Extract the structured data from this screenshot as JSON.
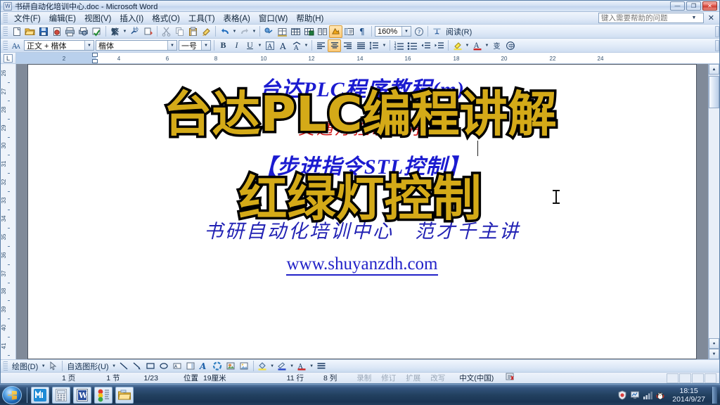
{
  "window": {
    "title": "书研自动化培训中心.doc - Microsoft Word",
    "app_icon": "word-document-icon",
    "minimize_label": "—",
    "restore_label": "❐",
    "close_label": "✕"
  },
  "menu": {
    "items": [
      {
        "label": "文件(F)",
        "name": "menu-file"
      },
      {
        "label": "编辑(E)",
        "name": "menu-edit"
      },
      {
        "label": "视图(V)",
        "name": "menu-view"
      },
      {
        "label": "插入(I)",
        "name": "menu-insert"
      },
      {
        "label": "格式(O)",
        "name": "menu-format"
      },
      {
        "label": "工具(T)",
        "name": "menu-tools"
      },
      {
        "label": "表格(A)",
        "name": "menu-table"
      },
      {
        "label": "窗口(W)",
        "name": "menu-window"
      },
      {
        "label": "帮助(H)",
        "name": "menu-help"
      }
    ],
    "help_box": {
      "placeholder": "键入需要帮助的问题",
      "value": "",
      "close_label": "✕"
    }
  },
  "standard_toolbar": {
    "zoom_value": "160%",
    "read_label": "阅读(R)",
    "buttons": [
      "new-document-icon",
      "open-folder-icon",
      "save-icon",
      "permission-icon",
      "print-icon",
      "print-preview-icon",
      "spell-check-icon",
      "traditional-chinese-icon",
      "research-icon",
      "translate-icon",
      "cut-icon",
      "copy-icon",
      "paste-icon",
      "format-painter-icon",
      "undo-icon",
      "redo-icon",
      "insert-hyperlink-icon",
      "tables-borders-icon",
      "insert-table-icon",
      "insert-excel-sheet-icon",
      "columns-icon",
      "drawing-icon",
      "document-map-icon",
      "show-formatting-icon",
      "help-icon"
    ]
  },
  "formatting_toolbar": {
    "style": "正文 + 楷体",
    "font": "楷体",
    "size": "一号",
    "bold_label": "B",
    "italic_label": "I",
    "underline_label": "U",
    "align_active": "center",
    "buttons": [
      "styles-formatting-icon",
      "bold-icon",
      "italic-icon",
      "underline-icon",
      "border-icon",
      "character-border-icon",
      "character-shading-icon",
      "align-left-icon",
      "align-center-icon",
      "align-right-icon",
      "justify-icon",
      "line-spacing-icon",
      "numbered-list-icon",
      "bulleted-list-icon",
      "decrease-indent-icon",
      "increase-indent-icon",
      "highlight-icon",
      "font-color-icon",
      "grow-font-icon",
      "phonetic-guide-icon"
    ]
  },
  "ruler": {
    "tab_stop_label": "L",
    "horizontal_ticks": [
      "2",
      "4",
      "6",
      "8",
      "10",
      "12",
      "14",
      "16",
      "18",
      "20",
      "22",
      "24"
    ],
    "vertical_ticks": [
      "26",
      "27",
      "28",
      "29",
      "30",
      "31",
      "32",
      "33",
      "34",
      "35",
      "36",
      "37",
      "38",
      "39",
      "40",
      "41"
    ]
  },
  "document": {
    "line_blue_top": "台达PLC程序教程(m)",
    "line_red": "交通灯控制程序",
    "line_blue_bottom": "【步进指令STL控制】",
    "line_center": "书研自动化培训中心　范才千主讲",
    "line_url": "www.shuyanzdh.com"
  },
  "overlay": {
    "line1": "台达PLC编程讲解",
    "line2": "红绿灯控制",
    "fill_color": "#d4aa18",
    "stroke_color": "#000000"
  },
  "drawing_toolbar": {
    "draw_label": "绘图(D)",
    "autoshapes_label": "自选图形(U)",
    "buttons": [
      "select-objects-icon",
      "line-icon",
      "arrow-icon",
      "rectangle-icon",
      "oval-icon",
      "text-box-icon",
      "vertical-text-box-icon",
      "wordart-icon",
      "diagram-icon",
      "clip-art-icon",
      "picture-icon",
      "fill-color-icon",
      "line-color-icon",
      "font-color-icon",
      "line-style-icon"
    ]
  },
  "statusbar": {
    "page": "1 页",
    "section": "1 节",
    "page_of": "1/23",
    "position_label": "位置",
    "position_value": "19厘米",
    "line": "11 行",
    "column": "8 列",
    "rec": "录制",
    "trk": "修订",
    "ext": "扩展",
    "ovr": "改写",
    "language": "中文(中国)",
    "spell_status_icon": "spell-check-status-icon"
  },
  "taskbar": {
    "start_label": "start-orb-icon",
    "buttons": [
      {
        "name": "taskbar-maxthon",
        "icon": "maxthon-browser-icon"
      },
      {
        "name": "taskbar-calculator",
        "icon": "calculator-icon"
      },
      {
        "name": "taskbar-word",
        "icon": "word-icon"
      },
      {
        "name": "taskbar-traffic-light",
        "icon": "traffic-light-icon"
      },
      {
        "name": "taskbar-folder",
        "icon": "folder-icon"
      }
    ],
    "tray_icons": [
      "security-icon",
      "network-monitor-icon",
      "signal-icon",
      "qq-penguin-icon"
    ],
    "time": "18:15",
    "date": "2014/9/27"
  }
}
